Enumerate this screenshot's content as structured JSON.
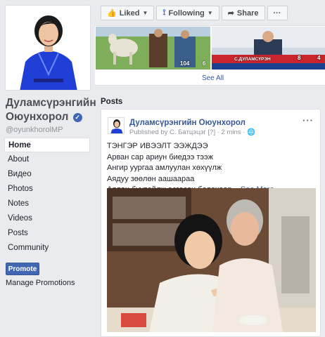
{
  "page": {
    "name": "Дуламсүрэнгийн Оюунхорол",
    "verified_icon": "verified-check-icon",
    "username": "@oyunkhorolMP"
  },
  "nav": {
    "items": [
      {
        "label": "Home",
        "active": true
      },
      {
        "label": "About"
      },
      {
        "label": "Видео"
      },
      {
        "label": "Photos"
      },
      {
        "label": "Notes"
      },
      {
        "label": "Videos"
      },
      {
        "label": "Posts"
      },
      {
        "label": "Community"
      }
    ]
  },
  "promote": {
    "button_label": "Promote",
    "manage_label": "Manage Promotions"
  },
  "actionbar": {
    "liked_label": "Liked",
    "following_label": "Following",
    "share_label": "Share",
    "more_label": "···"
  },
  "photos": {
    "photo1_stat": "104",
    "photo1_stat2": "6",
    "photo2_banner": "С.ДУЛАМСҮРЭН",
    "photo2_stat": "8",
    "photo2_stat2": "4",
    "see_all_label": "See All"
  },
  "posts": {
    "heading": "Posts",
    "post": {
      "author": "Дуламсүрэнгийн Оюунхорол",
      "meta": "Published by С. Батцэцэг [?] · 2 mins · ",
      "lines": [
        "ТЭНГЭР ИВЭЭЛТ ЭЭЖДЭЭ",
        "Арван сар ариун биедээ тээж",
        "Ангир уургаа амлуулан хөхүүлж",
        "Аядуу зөөлөн аашаараа",
        "Аялан бүүвэйлж өсгөсөн болохоор..."
      ],
      "see_more": "See More",
      "more_label": "···"
    }
  },
  "colors": {
    "facebook_blue": "#4267b2",
    "link_blue": "#365899",
    "background": "#e9ebee"
  }
}
